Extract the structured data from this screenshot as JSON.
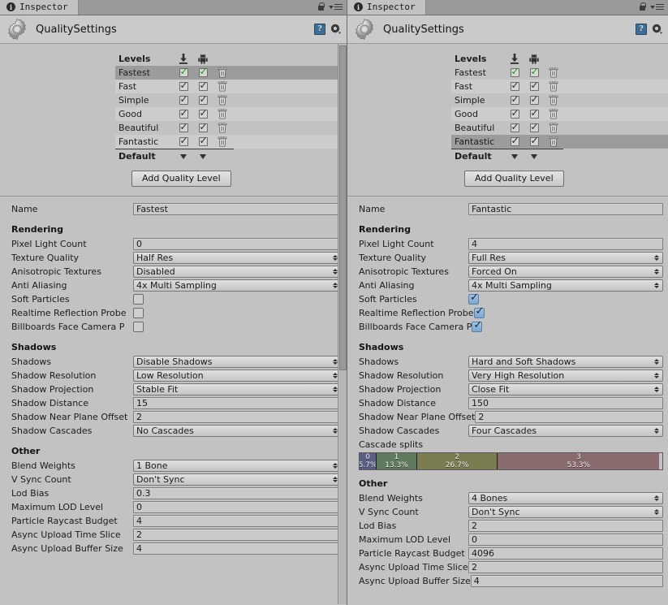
{
  "window": {
    "tab_label": "Inspector",
    "tab_icon": "info-circle-icon",
    "lock_icon": "lock-icon",
    "menu_icon": "hamburger-menu-icon",
    "object_title": "QualitySettings",
    "object_icon": "gear-icon",
    "help_icon": "help-book-icon",
    "settings_icon": "gear-dropdown-icon"
  },
  "levels": {
    "header_label": "Levels",
    "column_icons": [
      "standalone-download-icon",
      "android-robot-icon"
    ],
    "rows": [
      {
        "name": "Fastest",
        "standalone": true,
        "android": true,
        "delete_icon": "trash-icon"
      },
      {
        "name": "Fast",
        "standalone": true,
        "android": true,
        "delete_icon": "trash-icon"
      },
      {
        "name": "Simple",
        "standalone": true,
        "android": true,
        "delete_icon": "trash-icon"
      },
      {
        "name": "Good",
        "standalone": true,
        "android": true,
        "delete_icon": "trash-icon"
      },
      {
        "name": "Beautiful",
        "standalone": true,
        "android": true,
        "delete_icon": "trash-icon"
      },
      {
        "name": "Fantastic",
        "standalone": true,
        "android": true,
        "delete_icon": "trash-icon"
      }
    ],
    "default_label": "Default",
    "default_icon": "caret-down-icon",
    "add_button_label": "Add Quality Level"
  },
  "left": {
    "selected_index": 0,
    "name_label": "Name",
    "name_value": "Fastest",
    "rendering": {
      "title": "Rendering",
      "pixel_light_count_label": "Pixel Light Count",
      "pixel_light_count_value": "0",
      "texture_quality_label": "Texture Quality",
      "texture_quality_value": "Half Res",
      "anisotropic_textures_label": "Anisotropic Textures",
      "anisotropic_textures_value": "Disabled",
      "anti_aliasing_label": "Anti Aliasing",
      "anti_aliasing_value": "4x Multi Sampling",
      "soft_particles_label": "Soft Particles",
      "soft_particles_value": false,
      "realtime_reflection_probe_label": "Realtime Reflection Probe",
      "realtime_reflection_probe_value": false,
      "billboards_face_camera_label": "Billboards Face Camera P",
      "billboards_face_camera_value": false
    },
    "shadows": {
      "title": "Shadows",
      "shadows_label": "Shadows",
      "shadows_value": "Disable Shadows",
      "shadow_resolution_label": "Shadow Resolution",
      "shadow_resolution_value": "Low Resolution",
      "shadow_projection_label": "Shadow Projection",
      "shadow_projection_value": "Stable Fit",
      "shadow_distance_label": "Shadow Distance",
      "shadow_distance_value": "15",
      "shadow_near_plane_offset_label": "Shadow Near Plane Offset",
      "shadow_near_plane_offset_value": "2",
      "shadow_cascades_label": "Shadow Cascades",
      "shadow_cascades_value": "No Cascades"
    },
    "other": {
      "title": "Other",
      "blend_weights_label": "Blend Weights",
      "blend_weights_value": "1 Bone",
      "v_sync_count_label": "V Sync Count",
      "v_sync_count_value": "Don't Sync",
      "lod_bias_label": "Lod Bias",
      "lod_bias_value": "0.3",
      "maximum_lod_level_label": "Maximum LOD Level",
      "maximum_lod_level_value": "0",
      "particle_raycast_budget_label": "Particle Raycast Budget",
      "particle_raycast_budget_value": "4",
      "async_upload_time_slice_label": "Async Upload Time Slice",
      "async_upload_time_slice_value": "2",
      "async_upload_buffer_size_label": "Async Upload Buffer Size",
      "async_upload_buffer_size_value": "4"
    }
  },
  "right": {
    "selected_index": 5,
    "name_label": "Name",
    "name_value": "Fantastic",
    "rendering": {
      "title": "Rendering",
      "pixel_light_count_label": "Pixel Light Count",
      "pixel_light_count_value": "4",
      "texture_quality_label": "Texture Quality",
      "texture_quality_value": "Full Res",
      "anisotropic_textures_label": "Anisotropic Textures",
      "anisotropic_textures_value": "Forced On",
      "anti_aliasing_label": "Anti Aliasing",
      "anti_aliasing_value": "4x Multi Sampling",
      "soft_particles_label": "Soft Particles",
      "soft_particles_value": true,
      "realtime_reflection_probe_label": "Realtime Reflection Probe",
      "realtime_reflection_probe_value": true,
      "billboards_face_camera_label": "Billboards Face Camera P",
      "billboards_face_camera_value": true
    },
    "shadows": {
      "title": "Shadows",
      "shadows_label": "Shadows",
      "shadows_value": "Hard and Soft Shadows",
      "shadow_resolution_label": "Shadow Resolution",
      "shadow_resolution_value": "Very High Resolution",
      "shadow_projection_label": "Shadow Projection",
      "shadow_projection_value": "Close Fit",
      "shadow_distance_label": "Shadow Distance",
      "shadow_distance_value": "150",
      "shadow_near_plane_offset_label": "Shadow Near Plane Offset",
      "shadow_near_plane_offset_value": "2",
      "shadow_cascades_label": "Shadow Cascades",
      "shadow_cascades_value": "Four Cascades",
      "cascade_splits_label": "Cascade splits",
      "cascade_splits": [
        {
          "index": "0",
          "percent": "5.7%",
          "width": 5.7,
          "color": "#5b5f86"
        },
        {
          "index": "1",
          "percent": "13.3%",
          "width": 13.3,
          "color": "#5f7a5c"
        },
        {
          "index": "2",
          "percent": "26.7%",
          "width": 26.7,
          "color": "#7b7c52"
        },
        {
          "index": "3",
          "percent": "53.3%",
          "width": 53.3,
          "color": "#8a6b6d"
        }
      ]
    },
    "other": {
      "title": "Other",
      "blend_weights_label": "Blend Weights",
      "blend_weights_value": "4 Bones",
      "v_sync_count_label": "V Sync Count",
      "v_sync_count_value": "Don't Sync",
      "lod_bias_label": "Lod Bias",
      "lod_bias_value": "2",
      "maximum_lod_level_label": "Maximum LOD Level",
      "maximum_lod_level_value": "0",
      "particle_raycast_budget_label": "Particle Raycast Budget",
      "particle_raycast_budget_value": "4096",
      "async_upload_time_slice_label": "Async Upload Time Slice",
      "async_upload_time_slice_value": "2",
      "async_upload_buffer_size_label": "Async Upload Buffer Size",
      "async_upload_buffer_size_value": "4"
    }
  }
}
